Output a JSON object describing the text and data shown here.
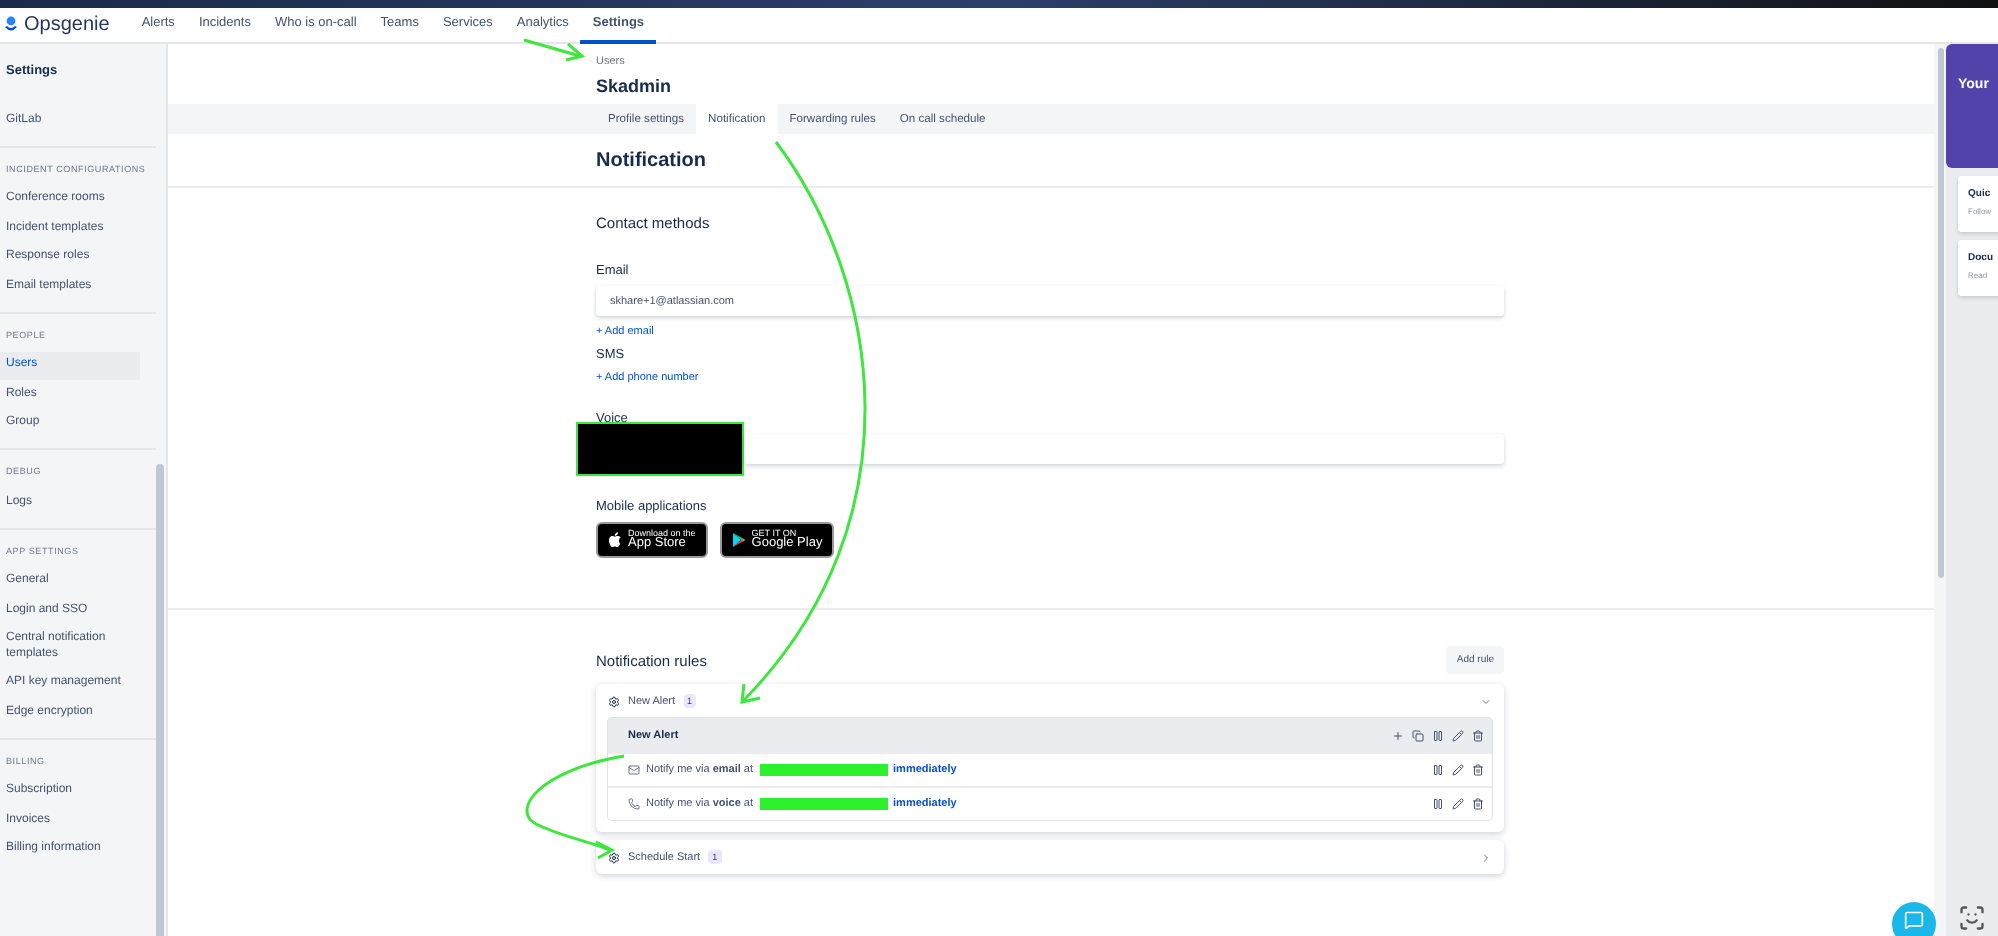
{
  "nav": {
    "brand": "Opsgenie",
    "items": [
      {
        "label": "Alerts",
        "selected": false
      },
      {
        "label": "Incidents",
        "selected": false
      },
      {
        "label": "Who is on-call",
        "selected": false
      },
      {
        "label": "Teams",
        "selected": false
      },
      {
        "label": "Services",
        "selected": false
      },
      {
        "label": "Analytics",
        "selected": false
      },
      {
        "label": "Settings",
        "selected": true
      }
    ]
  },
  "sidebar": {
    "title": "Settings",
    "groups": [
      {
        "items": [
          {
            "label": "GitLab",
            "selected": false
          }
        ]
      },
      {
        "heading": "INCIDENT CONFIGURATIONS",
        "items": [
          {
            "label": "Conference rooms",
            "selected": false
          },
          {
            "label": "Incident templates",
            "selected": false
          },
          {
            "label": "Response roles",
            "selected": false
          },
          {
            "label": "Email templates",
            "selected": false
          }
        ]
      },
      {
        "heading": "PEOPLE",
        "items": [
          {
            "label": "Users",
            "selected": true
          },
          {
            "label": "Roles",
            "selected": false
          },
          {
            "label": "Group",
            "selected": false
          }
        ]
      },
      {
        "heading": "DEBUG",
        "items": [
          {
            "label": "Logs",
            "selected": false
          }
        ]
      },
      {
        "heading": "APP SETTINGS",
        "items": [
          {
            "label": "General",
            "selected": false
          },
          {
            "label": "Login and SSO",
            "selected": false
          },
          {
            "label": "Central notification templates",
            "selected": false
          },
          {
            "label": "API key management",
            "selected": false
          },
          {
            "label": "Edge encryption",
            "selected": false
          }
        ]
      },
      {
        "heading": "BILLING",
        "items": [
          {
            "label": "Subscription",
            "selected": false
          },
          {
            "label": "Invoices",
            "selected": false
          },
          {
            "label": "Billing information",
            "selected": false
          }
        ]
      }
    ]
  },
  "breadcrumb": "Users",
  "user_name": "Skadmin",
  "tabs": [
    {
      "label": "Profile settings",
      "selected": false
    },
    {
      "label": "Notification",
      "selected": true
    },
    {
      "label": "Forwarding rules",
      "selected": false
    },
    {
      "label": "On call schedule",
      "selected": false
    }
  ],
  "page_title": "Notification",
  "contact_methods": {
    "title": "Contact methods",
    "email_label": "Email",
    "email_value": "skhare+1@atlassian.com",
    "add_email": "+ Add email",
    "sms_label": "SMS",
    "add_phone": "+ Add phone number",
    "voice_label": "Voice"
  },
  "mobile": {
    "title": "Mobile applications",
    "stores": [
      {
        "kind": "apple",
        "small": "Download on the",
        "name": "App Store"
      },
      {
        "kind": "google",
        "small": "GET IT ON",
        "name": "Google Play"
      }
    ]
  },
  "rules": {
    "title": "Notification rules",
    "add_button": "Add rule",
    "groups": [
      {
        "name": "New Alert",
        "count": "1",
        "expanded": true,
        "rule_name": "New Alert",
        "steps": [
          {
            "kind": "email",
            "text": "Notify me via **email** at",
            "timing": "immediately"
          },
          {
            "kind": "voice",
            "text": "Notify me via **voice** at",
            "timing": "immediately"
          }
        ]
      },
      {
        "name": "Schedule Start",
        "count": "1",
        "expanded": false
      }
    ]
  },
  "help_panel": {
    "title": "Your",
    "cards": [
      {
        "title": "Quic",
        "subtitle": "Follow"
      },
      {
        "title": "Docu",
        "subtitle": "Read"
      }
    ]
  }
}
